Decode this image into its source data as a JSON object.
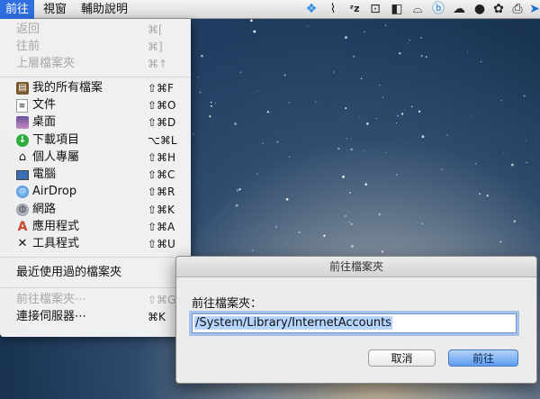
{
  "menubar": {
    "items": [
      {
        "label": "前往",
        "active": true
      },
      {
        "label": "視窗",
        "active": false
      },
      {
        "label": "輔助說明",
        "active": false
      }
    ],
    "status_icons": [
      "dropbox-icon",
      "paperclip-icon",
      "zz-icon",
      "airplay-box-icon",
      "app-icon",
      "hat-icon",
      "b-app-icon",
      "cloud-icon",
      "pawprint-icon",
      "printer-icon",
      "cursor-icon"
    ]
  },
  "go_menu": {
    "items": [
      {
        "label": "返回",
        "shortcut": "⌘[",
        "enabled": false
      },
      {
        "label": "往前",
        "shortcut": "⌘]",
        "enabled": false
      },
      {
        "label": "上層檔案夾",
        "shortcut": "⌘↑",
        "enabled": false
      },
      {
        "label": "我的所有檔案",
        "shortcut": "⇧⌘F",
        "enabled": true,
        "icon": "all-files-icon"
      },
      {
        "label": "文件",
        "shortcut": "⇧⌘O",
        "enabled": true,
        "icon": "documents-icon"
      },
      {
        "label": "桌面",
        "shortcut": "⇧⌘D",
        "enabled": true,
        "icon": "desktop-icon"
      },
      {
        "label": "下載項目",
        "shortcut": "⌥⌘L",
        "enabled": true,
        "icon": "downloads-icon"
      },
      {
        "label": "個人專屬",
        "shortcut": "⇧⌘H",
        "enabled": true,
        "icon": "home-icon"
      },
      {
        "label": "電腦",
        "shortcut": "⇧⌘C",
        "enabled": true,
        "icon": "computer-icon"
      },
      {
        "label": "AirDrop",
        "shortcut": "⇧⌘R",
        "enabled": true,
        "icon": "airdrop-icon"
      },
      {
        "label": "網路",
        "shortcut": "⇧⌘K",
        "enabled": true,
        "icon": "network-icon"
      },
      {
        "label": "應用程式",
        "shortcut": "⇧⌘A",
        "enabled": true,
        "icon": "applications-icon"
      },
      {
        "label": "工具程式",
        "shortcut": "⇧⌘U",
        "enabled": true,
        "icon": "utilities-icon"
      },
      {
        "label": "最近使用過的檔案夾",
        "shortcut": "",
        "enabled": true,
        "submenu": true
      },
      {
        "label": "前往檔案夾⋯",
        "shortcut": "⇧⌘G",
        "enabled": false
      },
      {
        "label": "連接伺服器⋯",
        "shortcut": "⌘K",
        "enabled": true
      }
    ]
  },
  "dialog": {
    "title": "前往檔案夾",
    "field_label": "前往檔案夾：",
    "field_value": "/System/Library/InternetAccounts",
    "cancel_label": "取消",
    "go_label": "前往"
  },
  "colors": {
    "menubar_highlight": "#2f6fdf",
    "default_button": "#5d9cf0",
    "text_selection": "#b5d5ff"
  }
}
